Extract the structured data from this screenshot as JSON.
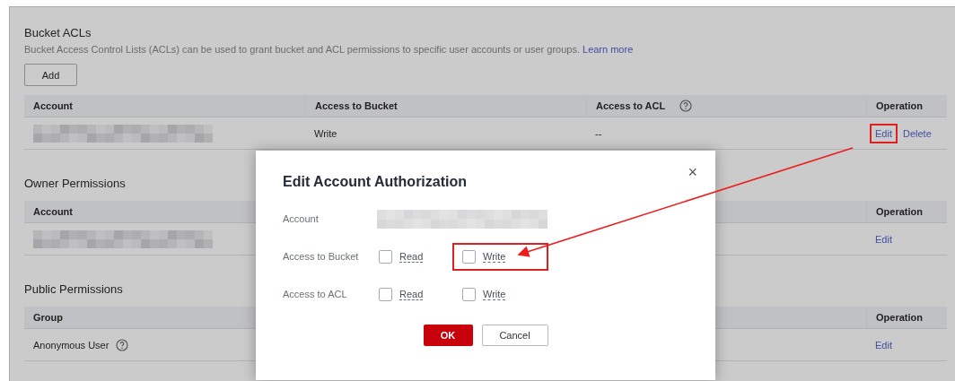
{
  "sections": [
    {
      "title": "Bucket ACLs",
      "description": "Bucket Access Control Lists (ACLs) can be used to grant bucket and ACL permissions to specific user accounts or user groups.",
      "link": "Learn more",
      "add_button": "Add",
      "columns": [
        {
          "label": "Account",
          "help": false
        },
        {
          "label": "Access to Bucket",
          "help": false
        },
        {
          "label": "Access to ACL",
          "help": true
        },
        {
          "label": "Operation",
          "help": false
        }
      ],
      "rows": [
        {
          "cells": [
            {
              "kind": "blurred"
            },
            {
              "kind": "text",
              "text": "Write"
            },
            {
              "kind": "text",
              "text": "--"
            },
            {
              "kind": "actions",
              "actions": [
                {
                  "label": "Edit",
                  "highlighted": true
                },
                {
                  "label": "Delete",
                  "highlighted": false
                }
              ]
            }
          ]
        }
      ]
    },
    {
      "title": "Owner Permissions",
      "columns": [
        {
          "label": "Account",
          "help": false
        },
        {
          "label": "Operation",
          "help": false
        }
      ],
      "rows": [
        {
          "cells": [
            {
              "kind": "blurred"
            },
            {
              "kind": "actions",
              "actions": [
                {
                  "label": "Edit",
                  "highlighted": false
                }
              ]
            }
          ]
        }
      ]
    },
    {
      "title": "Public Permissions",
      "columns": [
        {
          "label": "Group",
          "help": false
        },
        {
          "label": "Operation",
          "help": false
        }
      ],
      "rows": [
        {
          "cells": [
            {
              "kind": "help_text",
              "text": "Anonymous User"
            },
            {
              "kind": "actions",
              "actions": [
                {
                  "label": "Edit",
                  "highlighted": false
                }
              ]
            }
          ]
        }
      ]
    }
  ],
  "dialog": {
    "title": "Edit Account Authorization",
    "close": "×",
    "account_label": "Account",
    "permissions": [
      {
        "label": "Access to Bucket",
        "options": [
          {
            "label": "Read",
            "checked": false,
            "highlighted": false
          },
          {
            "label": "Write",
            "checked": false,
            "highlighted": true
          }
        ]
      },
      {
        "label": "Access to ACL",
        "options": [
          {
            "label": "Read",
            "checked": false,
            "highlighted": false
          },
          {
            "label": "Write",
            "checked": false,
            "highlighted": false
          }
        ]
      }
    ],
    "ok": "OK",
    "cancel": "Cancel"
  }
}
